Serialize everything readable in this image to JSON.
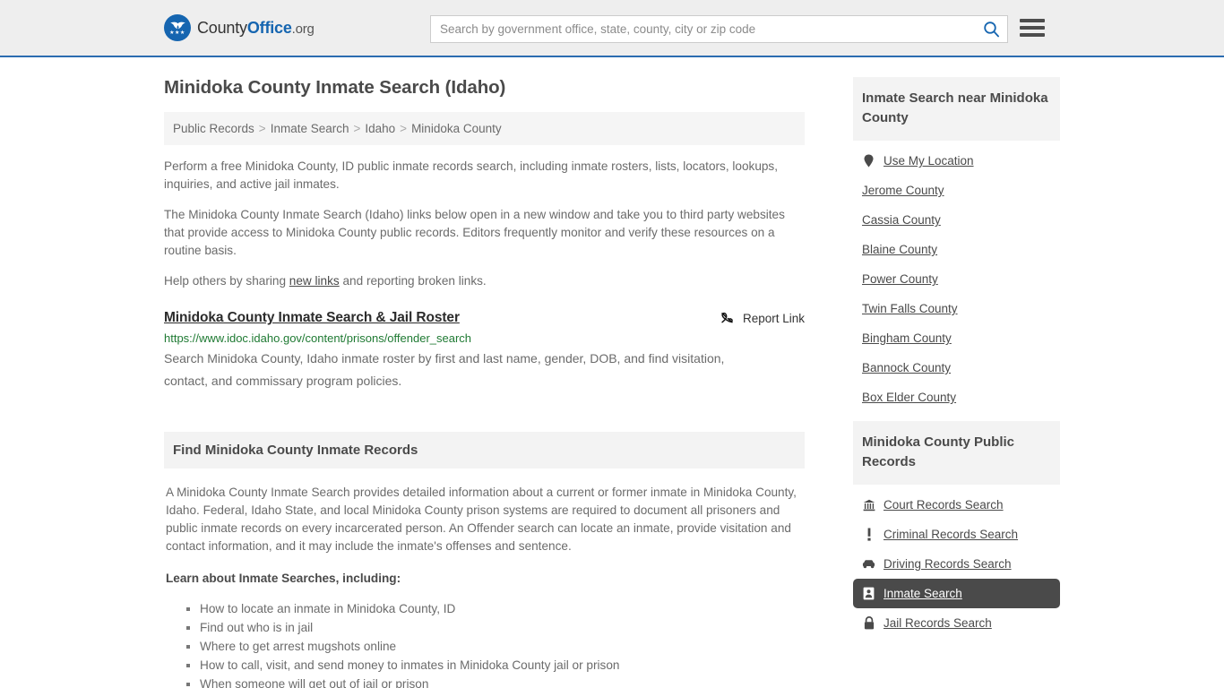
{
  "header": {
    "brand": {
      "part1": "County",
      "part2": "Office",
      "part3": ".org",
      "icon": "eagle-seal-icon"
    },
    "search": {
      "placeholder": "Search by government office, state, county, city or zip code",
      "value": "",
      "icon": "search-icon"
    },
    "menu": {
      "icon": "hamburger-menu-icon",
      "label": "Menu"
    },
    "accent_color": "#1565b0",
    "background_color": "#eeeeee"
  },
  "main": {
    "page_title": "Minidoka County Inmate Search (Idaho)",
    "breadcrumb": [
      {
        "label": "Public Records"
      },
      {
        "label": "Inmate Search"
      },
      {
        "label": "Idaho"
      },
      {
        "label": "Minidoka County"
      }
    ],
    "breadcrumb_separator": ">",
    "intro_paragraph": "Perform a free Minidoka County, ID public inmate records search, including inmate rosters, lists, locators, lookups, inquiries, and active jail inmates.",
    "secondary_paragraph": "The Minidoka County Inmate Search (Idaho) links below open in a new window and take you to third party websites that provide access to Minidoka County public records. Editors frequently monitor and verify these resources on a routine basis.",
    "share_prefix": "Help others by sharing ",
    "share_link": "new links",
    "share_suffix": " and reporting broken links.",
    "result": {
      "title": "Minidoka County Inmate Search & Jail Roster",
      "url": "https://www.idoc.idaho.gov/content/prisons/offender_search",
      "description": "Search Minidoka County, Idaho inmate roster by first and last name, gender, DOB, and find visitation, contact, and commissary program policies.",
      "report_label": "Report Link",
      "report_icon": "broken-link-icon",
      "url_color": "#1f7a33"
    },
    "section": {
      "heading": "Find Minidoka County Inmate Records",
      "paragraph": "A Minidoka County Inmate Search provides detailed information about a current or former inmate in Minidoka County, Idaho. Federal, Idaho State, and local Minidoka County prison systems are required to document all prisoners and public inmate records on every incarcerated person. An Offender search can locate an inmate, provide visitation and contact information, and it may include the inmate's offenses and sentence.",
      "learn_heading": "Learn about Inmate Searches, including:",
      "learn_items": [
        "How to locate an inmate in Minidoka County, ID",
        "Find out who is in jail",
        "Where to get arrest mugshots online",
        "How to call, visit, and send money to inmates in Minidoka County jail or prison",
        "When someone will get out of jail or prison"
      ]
    }
  },
  "sidebar": {
    "nearby": {
      "heading": "Inmate Search near Minidoka County",
      "items": [
        {
          "label": "Use My Location",
          "icon": "map-pin-icon"
        },
        {
          "label": "Jerome County",
          "icon": ""
        },
        {
          "label": "Cassia County",
          "icon": ""
        },
        {
          "label": "Blaine County",
          "icon": ""
        },
        {
          "label": "Power County",
          "icon": ""
        },
        {
          "label": "Twin Falls County",
          "icon": ""
        },
        {
          "label": "Bingham County",
          "icon": ""
        },
        {
          "label": "Bannock County",
          "icon": ""
        },
        {
          "label": "Box Elder County",
          "icon": ""
        }
      ]
    },
    "public_records": {
      "heading": "Minidoka County Public Records",
      "items": [
        {
          "label": "Court Records Search",
          "icon": "courthouse-icon",
          "active": false
        },
        {
          "label": "Criminal Records Search",
          "icon": "exclamation-icon",
          "active": false
        },
        {
          "label": "Driving Records Search",
          "icon": "car-icon",
          "active": false
        },
        {
          "label": "Inmate Search",
          "icon": "id-card-icon",
          "active": true
        },
        {
          "label": "Jail Records Search",
          "icon": "lock-icon",
          "active": false
        }
      ],
      "active_background": "#4a4a4a"
    }
  }
}
